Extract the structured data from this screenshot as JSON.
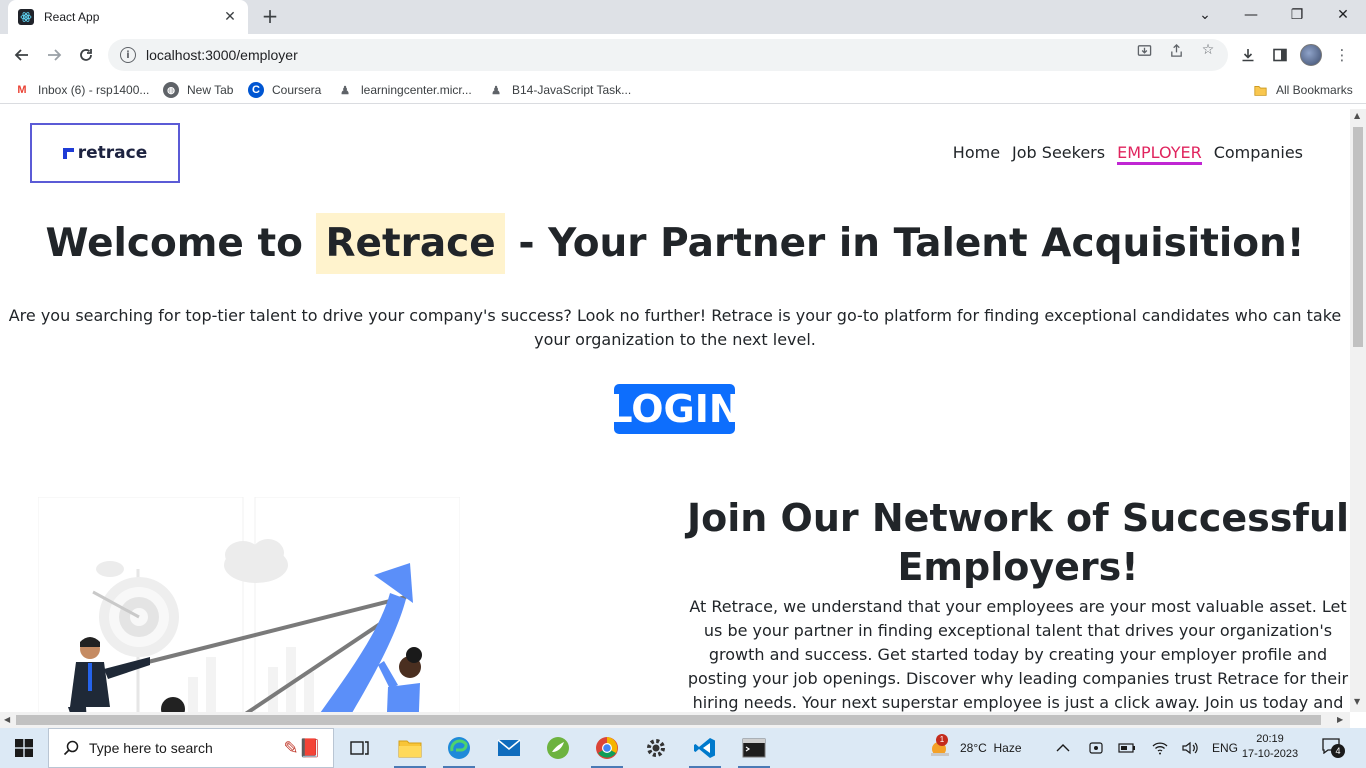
{
  "browser": {
    "tab_title": "React App",
    "url": "localhost:3000/employer",
    "bookmarks": [
      {
        "label": "Inbox (6) - rsp1400...",
        "icon": "gmail-icon"
      },
      {
        "label": "New Tab",
        "icon": "globe-icon"
      },
      {
        "label": "Coursera",
        "icon": "coursera-icon"
      },
      {
        "label": "learningcenter.micr...",
        "icon": "person-icon"
      },
      {
        "label": "B14-JavaScript Task...",
        "icon": "person-icon"
      }
    ],
    "all_bookmarks": "All Bookmarks"
  },
  "page": {
    "logo": "retrace",
    "nav": [
      {
        "label": "Home",
        "active": false
      },
      {
        "label": "Job Seekers",
        "active": false
      },
      {
        "label": "EMPLOYER",
        "active": true
      },
      {
        "label": "Companies",
        "active": false
      }
    ],
    "hero": {
      "title_before": "Welcome to",
      "title_highlight": "Retrace",
      "title_after": "- Your Partner in Talent Acquisition!",
      "description": "Are you searching for top-tier talent to drive your company's success? Look no further! Retrace is your go-to platform for finding exceptional candidates who can take your organization to the next level.",
      "login_label": "LOGIN"
    },
    "join": {
      "title": "Join Our Network of Successful Employers!",
      "description": "At Retrace, we understand that your employees are your most valuable asset. Let us be your partner in finding exceptional talent that drives your organization's growth and success. Get started today by creating your employer profile and posting your job openings. Discover why leading companies trust Retrace for their hiring needs. Your next superstar employee is just a click away. Join us today and elevate your team to new heights!"
    },
    "colors": {
      "accent": "#0d6efd",
      "highlight": "#fff3cd",
      "active_nav": "#e0245e",
      "logo_border": "#5b5bd6"
    }
  },
  "taskbar": {
    "search_placeholder": "Type here to search",
    "weather": "28°C  Haze",
    "weather_badge": "1",
    "language": "ENG",
    "time": "20:19",
    "date": "17-10-2023",
    "notifications": "4"
  }
}
